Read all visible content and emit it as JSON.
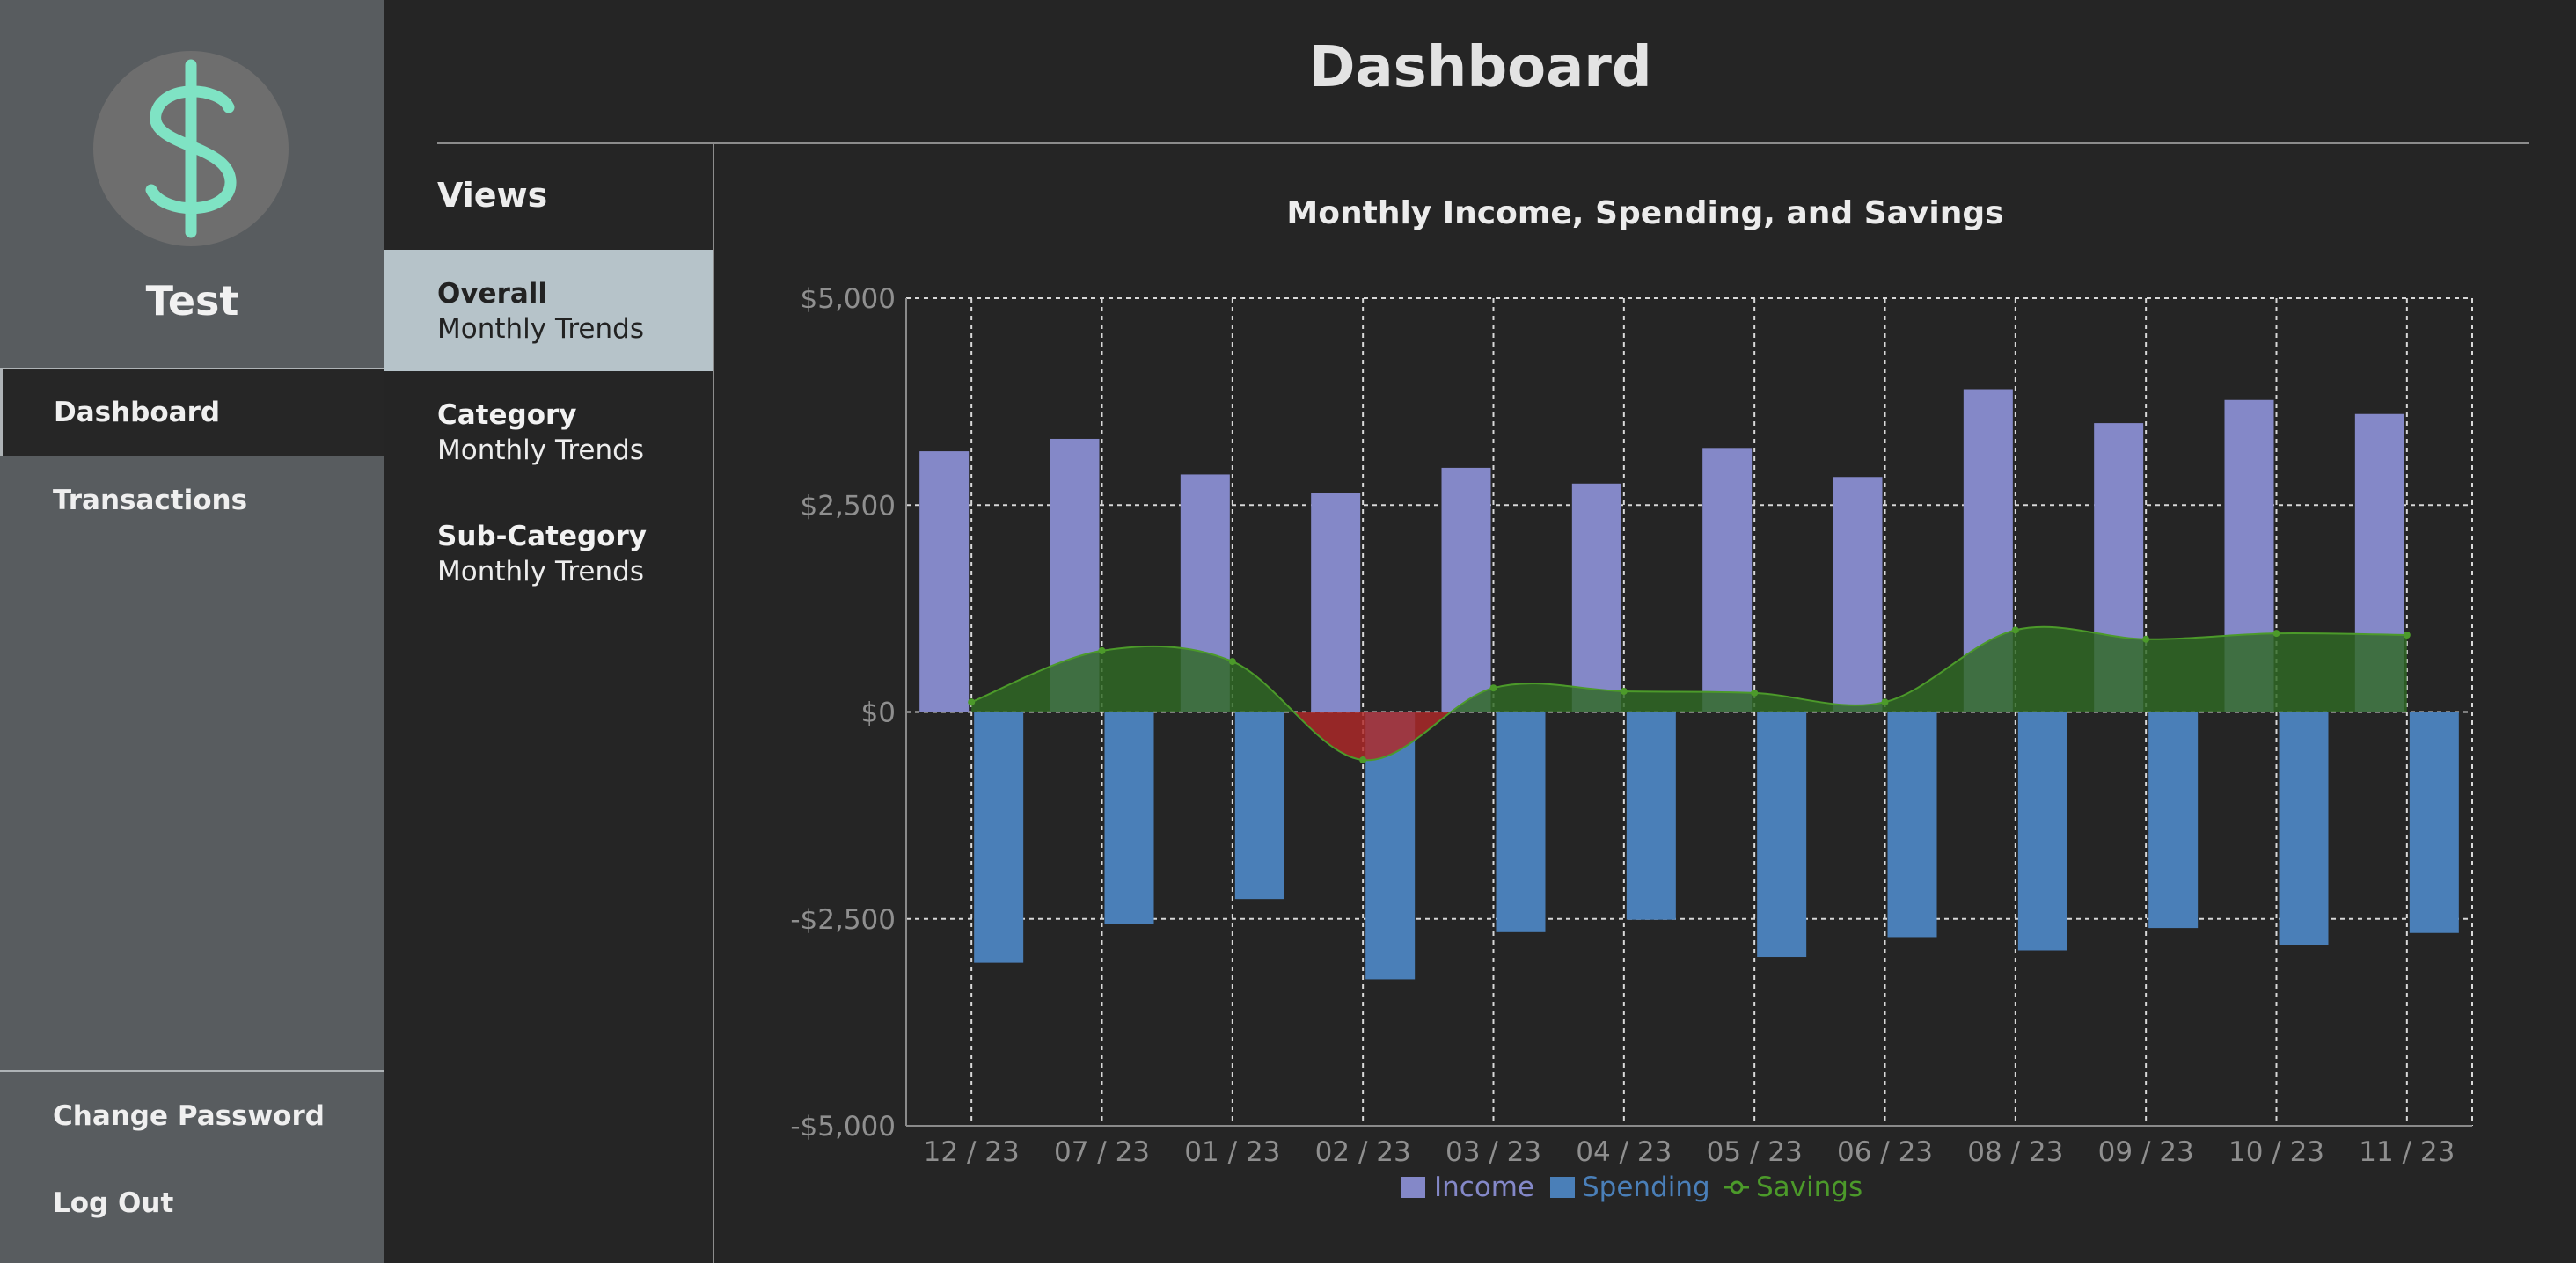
{
  "sidebar": {
    "user_name": "Test",
    "nav": [
      "Dashboard",
      "Transactions"
    ],
    "footer": [
      "Change Password",
      "Log Out"
    ]
  },
  "header": {
    "title": "Dashboard"
  },
  "views": {
    "heading": "Views",
    "items": [
      {
        "bold": "Overall",
        "sub": "Monthly Trends",
        "active": true
      },
      {
        "bold": "Category",
        "sub": "Monthly Trends",
        "active": false
      },
      {
        "bold": "Sub-Category",
        "sub": "Monthly Trends",
        "active": false
      }
    ]
  },
  "colors": {
    "income": "#8488c8",
    "spending": "#4a7fb8",
    "savings_positive": "#2f6a24",
    "savings_negative": "#b02828",
    "savings_line": "#4c9a2a",
    "accent_active": "#b6c3c9"
  },
  "icons": {
    "logo": "dollar-icon"
  },
  "chart_data": {
    "type": "bar",
    "title": "Monthly Income, Spending, and Savings",
    "xlabel": "",
    "ylabel": "",
    "categories": [
      "12 / 23",
      "07 / 23",
      "01 / 23",
      "02 / 23",
      "03 / 23",
      "04 / 23",
      "05 / 23",
      "06 / 23",
      "08 / 23",
      "09 / 23",
      "10 / 23",
      "11 / 23"
    ],
    "ylim": [
      -5000,
      5000
    ],
    "y_ticks": [
      "$5,000",
      "$2,500",
      "$0",
      "-$2,500",
      "-$5,000"
    ],
    "y_tick_values": [
      5000,
      2500,
      0,
      -2500,
      -5000
    ],
    "grid": true,
    "legend_position": "bottom-center",
    "series": [
      {
        "name": "Income",
        "type": "bar",
        "values": [
          3150,
          3300,
          2870,
          2650,
          2950,
          2760,
          3190,
          2840,
          3900,
          3490,
          3770,
          3600
        ]
      },
      {
        "name": "Spending",
        "type": "bar",
        "values": [
          -3030,
          -2560,
          -2260,
          -3230,
          -2660,
          -2510,
          -2960,
          -2720,
          -2880,
          -2610,
          -2820,
          -2670
        ]
      },
      {
        "name": "Savings",
        "type": "area",
        "values": [
          120,
          740,
          610,
          -580,
          290,
          250,
          230,
          120,
          990,
          880,
          950,
          930
        ]
      }
    ]
  }
}
